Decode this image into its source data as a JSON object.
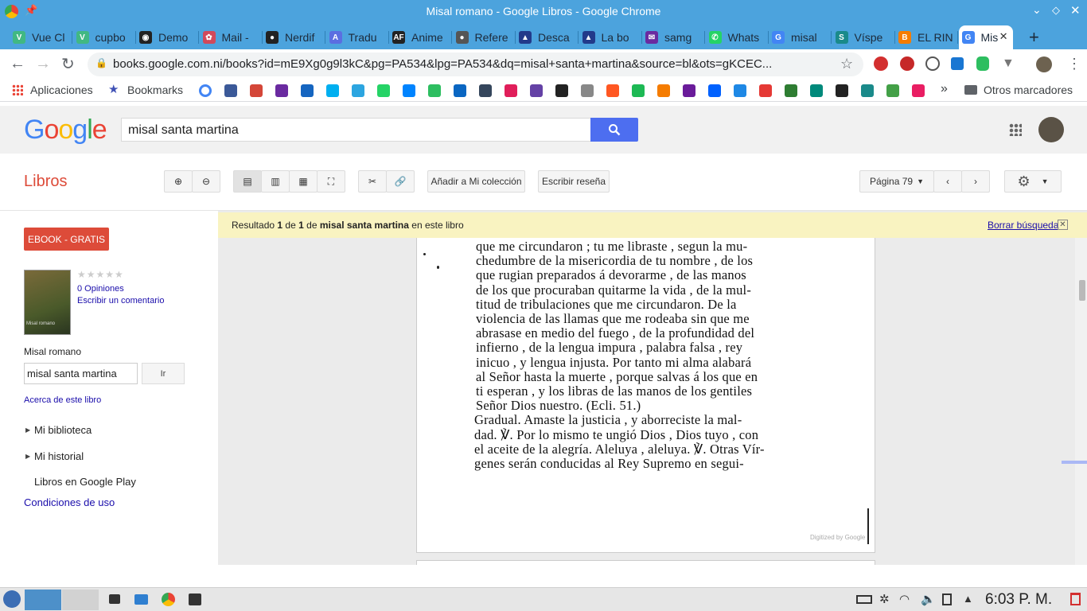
{
  "window": {
    "title": "Misal romano - Google Libros - Google Chrome"
  },
  "tabs": [
    {
      "label": "Vue Cl",
      "color": "#41b883",
      "glyph": "V"
    },
    {
      "label": "cupbo",
      "color": "#41b883",
      "glyph": "V"
    },
    {
      "label": "Demo",
      "color": "#222",
      "glyph": "◉"
    },
    {
      "label": "Mail -",
      "color": "#d1495b",
      "glyph": "✿"
    },
    {
      "label": "Nerdif",
      "color": "#222",
      "glyph": "●"
    },
    {
      "label": "Tradu",
      "color": "#5b6ee1",
      "glyph": "A"
    },
    {
      "label": "Anime",
      "color": "#222",
      "glyph": "AF"
    },
    {
      "label": "Refere",
      "color": "#555",
      "glyph": "●"
    },
    {
      "label": "Desca",
      "color": "#223a8a",
      "glyph": "▲"
    },
    {
      "label": "La bo",
      "color": "#223a8a",
      "glyph": "▲"
    },
    {
      "label": "samg",
      "color": "#6a2aa0",
      "glyph": "✉"
    },
    {
      "label": "Whats",
      "color": "#25d366",
      "glyph": "✆"
    },
    {
      "label": "misal",
      "color": "#4285f4",
      "glyph": "G"
    },
    {
      "label": "Víspe",
      "color": "#1a8a8a",
      "glyph": "S"
    },
    {
      "label": "EL RIN",
      "color": "#f57c00",
      "glyph": "B"
    },
    {
      "label": "Mis",
      "color": "#4285f4",
      "glyph": "G",
      "active": true
    }
  ],
  "omnibox": {
    "url": "books.google.com.ni/books?id=mE9Xg0g9l3kC&pg=PA534&lpg=PA534&dq=misal+santa+martina&source=bl&ots=gKCEC..."
  },
  "bookmarks_bar": {
    "apps": "Aplicaciones",
    "bookmarks": "Bookmarks",
    "more": "»",
    "other": "Otros marcadores"
  },
  "google": {
    "query": "misal santa martina"
  },
  "libros": {
    "brand": "Libros",
    "add_collection": "Añadir a Mi colección",
    "write_review": "Escribir reseña",
    "page_select": "Página 79"
  },
  "sidebar": {
    "ebook_button": "EBOOK - GRATIS",
    "opinions": "0 Opiniones",
    "write_comment": "Escribir un comentario",
    "book_title": "Misal romano",
    "cover_caption": "Misal romano",
    "search_value": "misal santa martina",
    "go_button": "Ir",
    "about": "Acerca de este libro",
    "my_library": "Mi biblioteca",
    "my_history": "Mi historial",
    "play": "Libros en Google Play",
    "terms": "Condiciones de uso"
  },
  "result_bar": {
    "prefix": "Resultado",
    "n1": "1",
    "de1": "de",
    "n2": "1",
    "de2": "de",
    "query": "misal santa martina",
    "suffix": "en este libro",
    "clear": "Borrar búsqueda"
  },
  "book_text": [
    "que me circundaron ; tu me libraste , segun la mu-",
    "chedumbre de la misericordia de tu nombre , de los",
    "que rugian preparados á devorarme , de las manos",
    "de los que procuraban quitarme la vida , de la mul-",
    "titud de tribulaciones que me circundaron. De la",
    "violencia de las llamas que me rodeaba sin que me",
    "abrasase en medio del fuego , de la profundidad del",
    "infierno , de la lengua impura , palabra falsa , rey",
    "inicuo , y lengua injusta. Por tanto mi alma alabará",
    "al Señor hasta la muerte , porque salvas á los que en",
    "ti esperan , y los libras de las manos de los gentiles",
    "Señor Dios nuestro.          (Ecli. 51.)",
    "   Gradual.   Amaste la justicia , y aborreciste la mal-",
    "dad. ℣. Por lo mismo te ungió Dios , Dios tuyo , con",
    "el aceite de la alegría. Aleluya , aleluya. ℣. Otras Vír-",
    "genes serán conducidas al Rey Supremo en segui-"
  ],
  "digitized": "Digitized by Google",
  "taskbar": {
    "clock": "6:03 P. M."
  },
  "colors": {
    "title_bar": "#4ca3dd",
    "google_blue": "#4d6ef0",
    "ebook_red": "#dd4b39",
    "link_blue": "#1a0dab",
    "libros_red": "#dd4b39"
  }
}
